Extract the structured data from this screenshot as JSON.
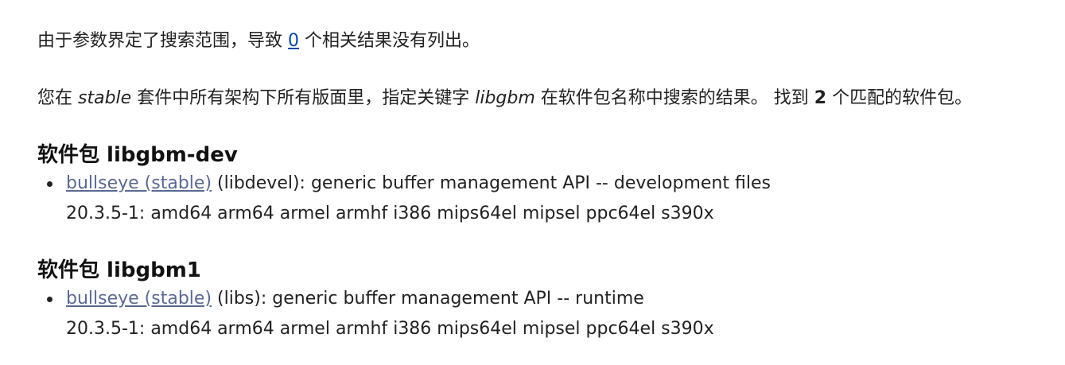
{
  "summary": {
    "prefix": "由于参数界定了搜索范围，导致",
    "count": "0",
    "suffix": "个相关结果没有列出。"
  },
  "search_result": {
    "part1": "您在",
    "suite": "stable",
    "part2": "套件中所有架构下所有版面里，指定关键字",
    "keyword": "libgbm",
    "part3": "在软件包名称中搜索的结果。 找到",
    "match_count": "2",
    "part4": "个匹配的软件包。"
  },
  "packages": [
    {
      "heading": "软件包 libgbm-dev",
      "suite_link": "bullseye (stable)",
      "description": "(libdevel): generic buffer management API -- development files",
      "versions": "20.3.5-1: amd64 arm64 armel armhf i386 mips64el mipsel ppc64el s390x"
    },
    {
      "heading": "软件包 libgbm1",
      "suite_link": "bullseye (stable)",
      "description": "(libs): generic buffer management API -- runtime",
      "versions": "20.3.5-1: amd64 arm64 armel armhf i386 mips64el mipsel ppc64el s390x"
    }
  ]
}
